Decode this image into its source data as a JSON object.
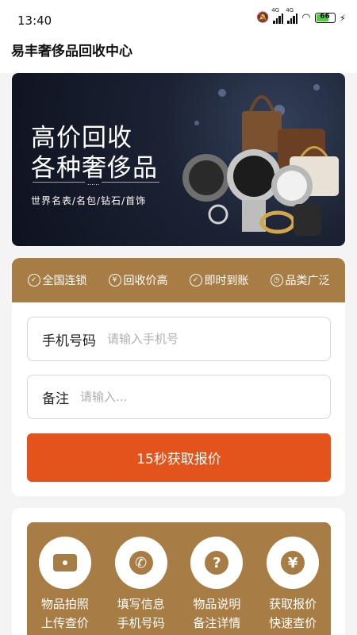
{
  "status": {
    "time": "13:40",
    "network1": "4G",
    "network2": "4G",
    "battery": "66"
  },
  "header": {
    "title": "易丰奢侈品回收中心"
  },
  "banner": {
    "line1": "高价回收",
    "line2": "各种奢侈品",
    "dots": "......",
    "tags": "世界名表/名包/钻石/首饰"
  },
  "features": [
    {
      "icon": "shield-check-icon",
      "label": "全国连锁"
    },
    {
      "icon": "yen-icon",
      "label": "回收价高"
    },
    {
      "icon": "check-circle-icon",
      "label": "即时到账"
    },
    {
      "icon": "watch-icon",
      "label": "品类广泛"
    }
  ],
  "form": {
    "phone_label": "手机号码",
    "phone_placeholder": "请输入手机号",
    "note_label": "备注",
    "note_placeholder": "请输入...",
    "submit_label": "15秒获取报价"
  },
  "steps": [
    {
      "icon": "camera-icon",
      "line1": "物品拍照",
      "line2": "上传查价"
    },
    {
      "icon": "phone-icon",
      "line1": "填写信息",
      "line2": "手机号码"
    },
    {
      "icon": "question-icon",
      "line1": "物品说明",
      "line2": "备注详情"
    },
    {
      "icon": "yen-icon",
      "line1": "获取报价",
      "line2": "快速查价"
    }
  ],
  "colors": {
    "accent": "#a87c45",
    "button": "#e4531c"
  }
}
